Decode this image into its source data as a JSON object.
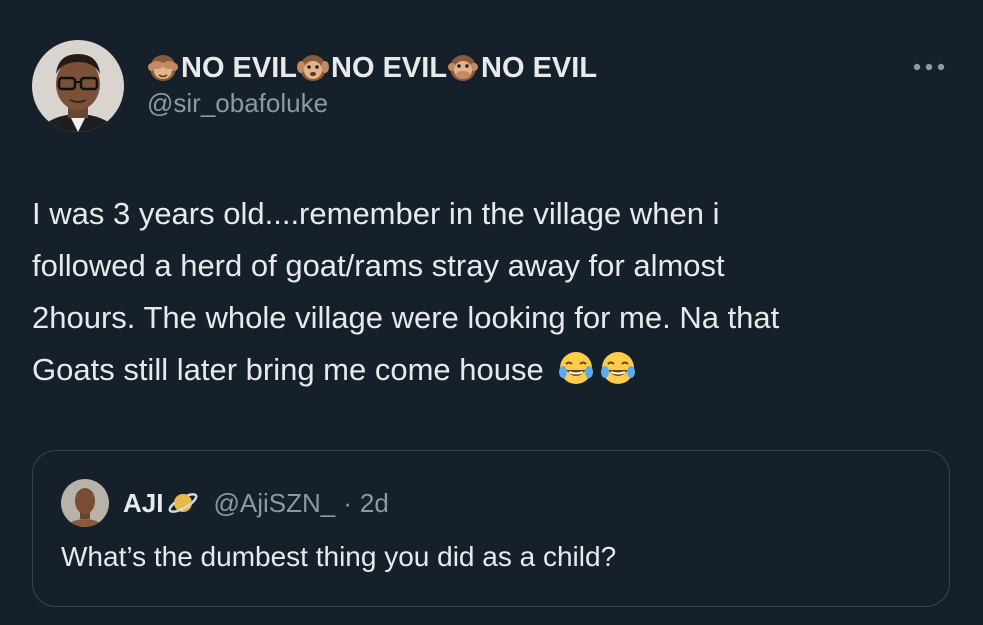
{
  "tweet": {
    "author": {
      "name_parts": [
        "NO EVIL",
        "NO EVIL",
        "NO EVIL"
      ],
      "name_emojis": [
        "see-no-evil-monkey-icon",
        "hear-no-evil-monkey-icon",
        "speak-no-evil-monkey-icon"
      ],
      "handle": "@sir_obafoluke"
    },
    "more_icon": "more-options-icon",
    "text_lines": [
      "I was 3 years old....remember in the village when i",
      "followed a herd of goat/rams stray away for almost",
      "2hours. The whole village were looking for me. Na that",
      "Goats still later bring me come house"
    ],
    "text_emojis": [
      "face-with-tears-of-joy-icon",
      "face-with-tears-of-joy-icon"
    ]
  },
  "quote": {
    "name": "AJI",
    "name_emoji": "ringed-planet-icon",
    "handle": "@AjiSZN_",
    "separator": "·",
    "time": "2d",
    "text": "What’s the dumbest thing you did as a child?"
  },
  "colors": {
    "background": "#15202b",
    "primary_text": "#e7e9ea",
    "secondary_text": "#8b98a5",
    "border": "#38444d"
  }
}
